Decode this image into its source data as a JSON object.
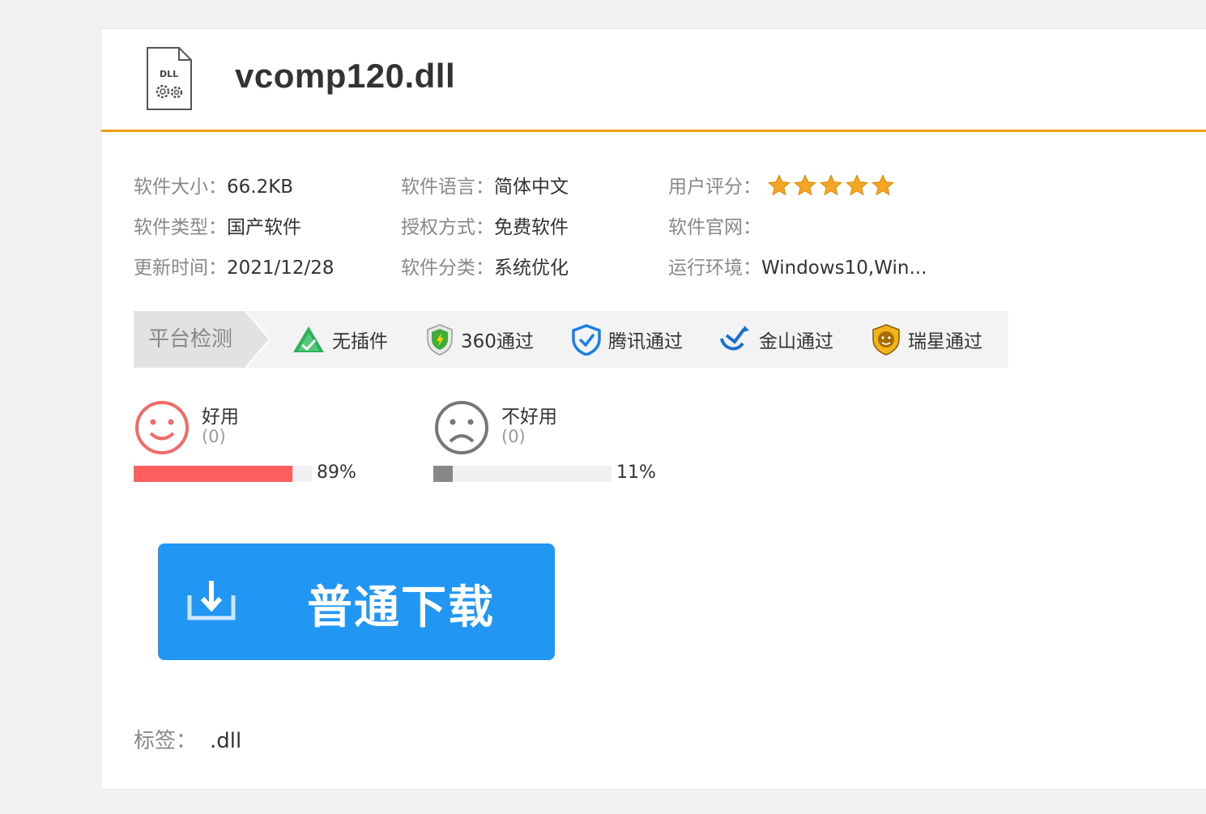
{
  "header": {
    "title": "vcomp120.dll",
    "file_icon_text": "DLL"
  },
  "info": {
    "size_label": "软件大小：",
    "size_value": "66.2KB",
    "type_label": "软件类型：",
    "type_value": "国产软件",
    "update_label": "更新时间：",
    "update_value": "2021/12/28",
    "lang_label": "软件语言：",
    "lang_value": "简体中文",
    "license_label": "授权方式：",
    "license_value": "免费软件",
    "category_label": "软件分类：",
    "category_value": "系统优化",
    "rating_label": "用户评分：",
    "rating_stars": 5,
    "site_label": "软件官网：",
    "site_value": "",
    "env_label": "运行环境：",
    "env_value": "Windows10,Win..."
  },
  "platform": {
    "label": "平台检测",
    "badges": [
      {
        "text": "无插件",
        "icon": "no-plugin-icon"
      },
      {
        "text": "360通过",
        "icon": "360-shield-icon"
      },
      {
        "text": "腾讯通过",
        "icon": "tencent-shield-icon"
      },
      {
        "text": "金山通过",
        "icon": "kingsoft-icon"
      },
      {
        "text": "瑞星通过",
        "icon": "rising-lion-icon"
      }
    ]
  },
  "votes": {
    "good": {
      "label": "好用",
      "count": "(0)",
      "percent_text": "89%",
      "fraction": 0.89,
      "color": "#ff5f5f"
    },
    "bad": {
      "label": "不好用",
      "count": "(0)",
      "percent_text": "11%",
      "fraction": 0.11,
      "color": "#888888"
    }
  },
  "download": {
    "label": "普通下载",
    "color": "#2196f3"
  },
  "tags": {
    "label": "标签：",
    "value": ".dll"
  },
  "colors": {
    "accent": "#f39c12",
    "star": "#f5a623"
  }
}
